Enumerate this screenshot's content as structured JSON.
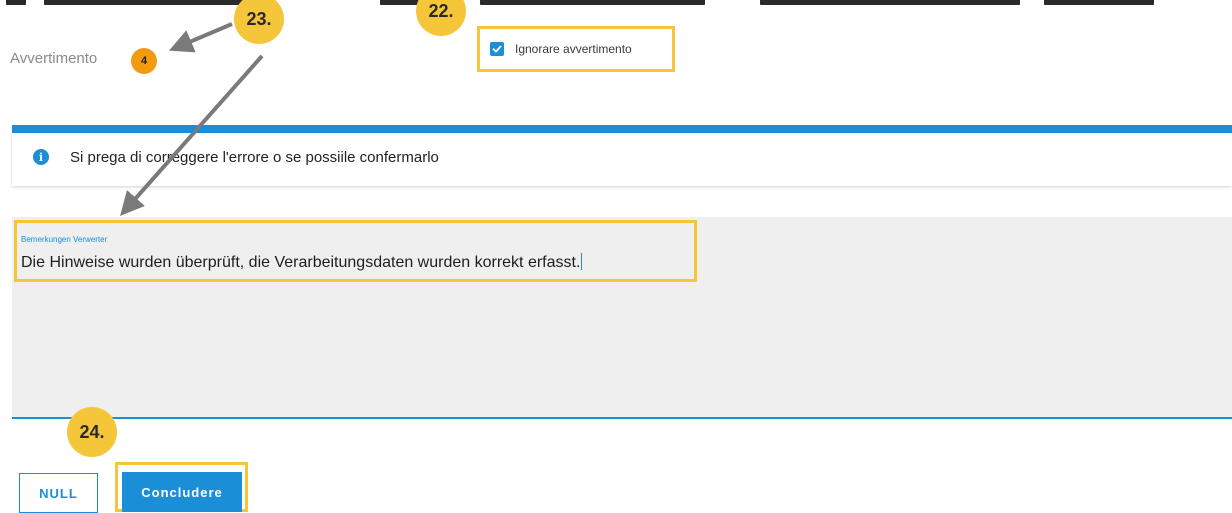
{
  "warning": {
    "label": "Avvertimento",
    "count": "4",
    "ignore_label": "Ignorare avvertimento",
    "ignore_checked": true
  },
  "info_banner": {
    "message": "Si prega di correggere l'errore o se possiile confermarlo",
    "icon": "info-icon"
  },
  "remarks": {
    "label": "Bemerkungen Verwerter",
    "value": "Die Hinweise wurden überprüft, die Verarbeitungsdaten wurden korrekt erfasst."
  },
  "buttons": {
    "null_label": "NULL",
    "conclude_label": "Concludere"
  },
  "callouts": {
    "c22": "22.",
    "c23": "23.",
    "c24": "24."
  },
  "colors": {
    "accent": "#1a8fd8",
    "highlight": "#f6c63a",
    "badge": "#f29a12"
  }
}
